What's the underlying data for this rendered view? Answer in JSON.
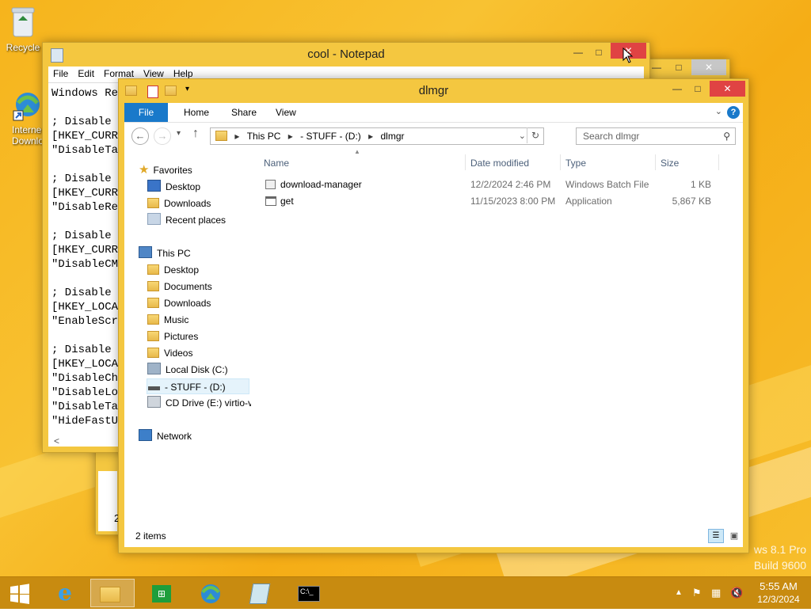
{
  "desktop": {
    "icons": [
      {
        "label": "Recycle"
      },
      {
        "label": "Interne Downlo"
      }
    ],
    "watermark": {
      "line1": "ws 8.1 Pro",
      "line2": "Build 9600"
    }
  },
  "notepad_back": {
    "title": "cool - Notepad",
    "menu": [
      "File",
      "Edit",
      "Format",
      "View",
      "Help"
    ],
    "lines": [
      "Windows Re",
      "",
      "; Disable",
      "[HKEY_CURR",
      "\"DisableTa",
      "",
      "; Disable",
      "[HKEY_CURR",
      "\"DisableRe",
      "",
      "; Disable",
      "[HKEY_CURR",
      "\"DisableCM",
      "",
      "; Disable",
      "[HKEY_LOCA",
      "\"EnableScr",
      "",
      "; Disable",
      "[HKEY_LOCA",
      "\"DisableCh",
      "\"DisableLo",
      "\"DisableTa",
      "\"HideFastU"
    ],
    "hscroll_arrow": "<",
    "partial": "2"
  },
  "explorer": {
    "title": "dlmgr",
    "ribbon_tabs": [
      "File",
      "Home",
      "Share",
      "View"
    ],
    "address": {
      "this_pc": "This PC",
      "drive": "- STUFF - (D:)",
      "folder": "dlmgr"
    },
    "search_placeholder": "Search dlmgr",
    "nav": {
      "favorites": "Favorites",
      "fav_items": [
        "Desktop",
        "Downloads",
        "Recent places"
      ],
      "this_pc": "This PC",
      "pc_items": [
        "Desktop",
        "Documents",
        "Downloads",
        "Music",
        "Pictures",
        "Videos",
        "Local Disk (C:)",
        "- STUFF - (D:)",
        "CD Drive (E:) virtio-v"
      ],
      "network": "Network"
    },
    "columns": {
      "name": "Name",
      "date": "Date modified",
      "type": "Type",
      "size": "Size"
    },
    "files": [
      {
        "name": "download-manager",
        "date": "12/2/2024 2:46 PM",
        "type": "Windows Batch File",
        "size": "1 KB",
        "icon": "batch-file-icon"
      },
      {
        "name": "get",
        "date": "11/15/2023 8:00 PM",
        "type": "Application",
        "size": "5,867 KB",
        "icon": "application-icon"
      }
    ],
    "status": "2 items"
  },
  "taskbar": {
    "clock_time": "5:55 AM",
    "clock_date": "12/3/2024"
  },
  "colors": {
    "accent": "#1979ca",
    "desktop": "#f6b41c",
    "taskbar": "#c88b10",
    "close": "#e04343"
  }
}
